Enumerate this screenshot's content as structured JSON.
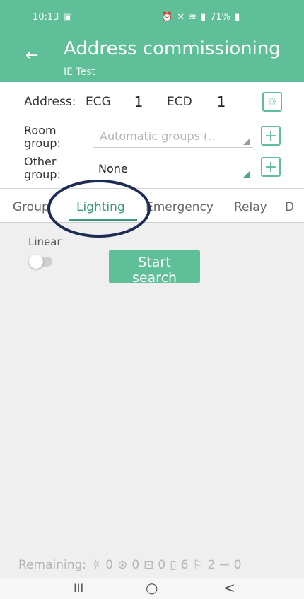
{
  "status": {
    "time": "10:13",
    "battery": "71%",
    "icons": [
      "image-icon",
      "alarm-icon",
      "mute-icon",
      "wifi-icon",
      "signal-icon",
      "battery-icon"
    ]
  },
  "appbar": {
    "title": "Address commissioning",
    "subtitle": "IE Test"
  },
  "form": {
    "address_label": "Address:",
    "ecg_label": "ECG",
    "ecg_value": "1",
    "ecd_label": "ECD",
    "ecd_value": "1",
    "room_group_label_1": "Room",
    "room_group_label_2": "group:",
    "room_group_value": "Automatic groups (..",
    "other_group_label_1": "Other",
    "other_group_label_2": "group:",
    "other_group_value": "None"
  },
  "tabs": [
    "Group",
    "Lighting",
    "Emergency",
    "Relay",
    "D"
  ],
  "content": {
    "linear_label": "Linear",
    "start_line1": "Start",
    "start_line2": "search"
  },
  "remaining": {
    "label": "Remaining:",
    "counts": [
      "0",
      "0",
      "0",
      "6",
      "2",
      "0"
    ]
  },
  "nav": {
    "recents": "III",
    "home": "○",
    "back": "<"
  },
  "colors": {
    "accent": "#5fbf98",
    "accent_dark": "#3d9a79",
    "annotation": "#1e2b55"
  }
}
